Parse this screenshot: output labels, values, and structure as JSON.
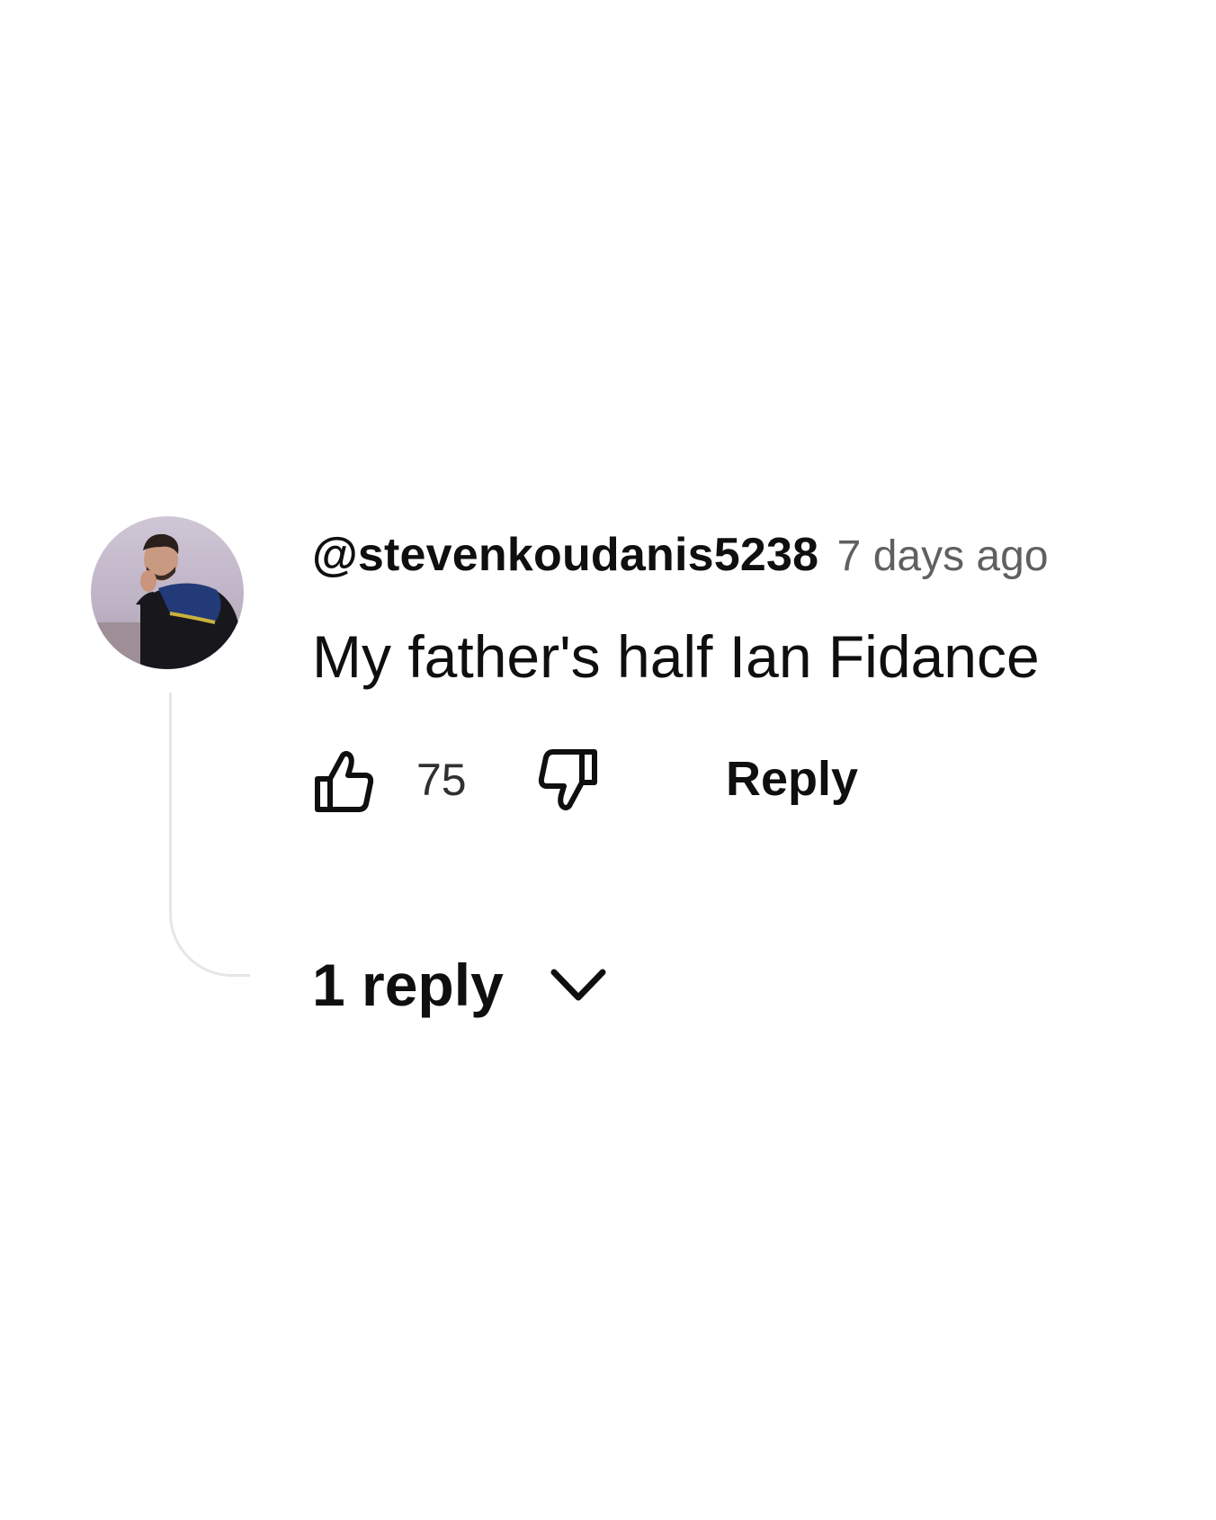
{
  "comment": {
    "author": "@stevenkoudanis5238",
    "timestamp": "7 days ago",
    "text": "My father's half Ian Fidance",
    "like_count": "75",
    "reply_label": "Reply",
    "replies_toggle_label": "1 reply"
  },
  "icons": {
    "like": "thumbs-up-icon",
    "dislike": "thumbs-down-icon",
    "expand": "chevron-down-icon"
  },
  "colors": {
    "background": "#ffffff",
    "primary_text": "#0f0f0f",
    "secondary_text": "#606060",
    "thread_line": "#e6e6e6"
  }
}
